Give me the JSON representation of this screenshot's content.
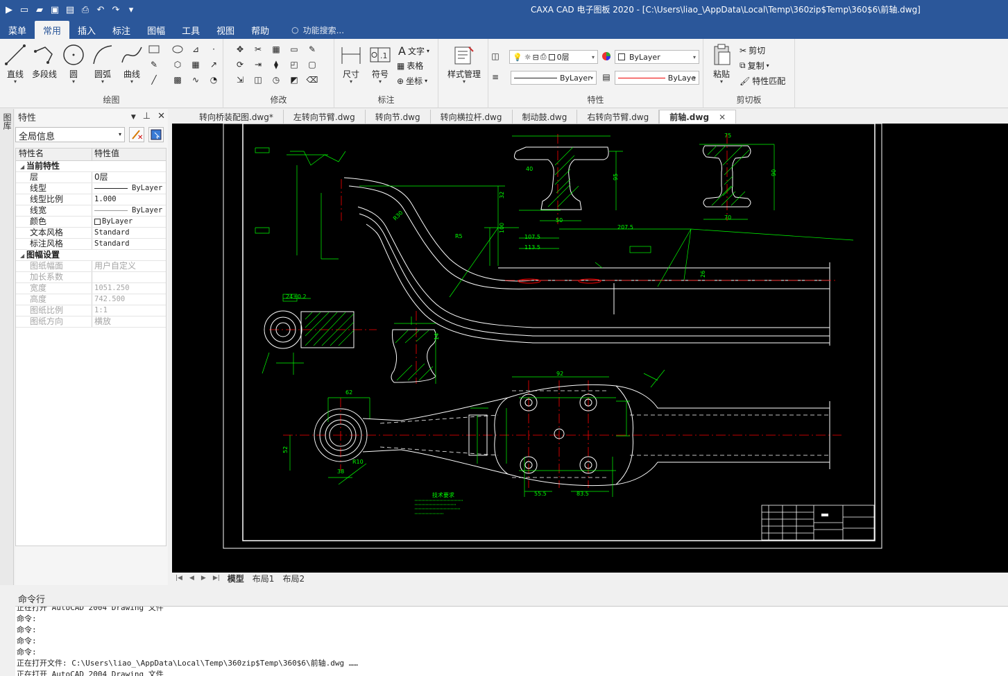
{
  "window": {
    "title": "CAXA CAD 电子图板 2020 - [C:\\Users\\liao_\\AppData\\Local\\Temp\\360zip$Temp\\360$6\\前轴.dwg]"
  },
  "menu": {
    "items": [
      "菜单",
      "常用",
      "插入",
      "标注",
      "图幅",
      "工具",
      "视图",
      "帮助"
    ],
    "active": "常用",
    "search_placeholder": "功能搜索..."
  },
  "ribbon": {
    "draw": {
      "label": "绘图",
      "line": "直线",
      "polyline": "多段线",
      "circle": "圆",
      "arc": "圆弧",
      "curve": "曲线"
    },
    "modify": {
      "label": "修改"
    },
    "annotate": {
      "label": "标注",
      "dimension": "尺寸",
      "symbol": "符号",
      "text": "文字",
      "table": "表格",
      "coord": "坐标"
    },
    "style": {
      "label": "样式管理"
    },
    "properties": {
      "label": "特性",
      "layer": "0层",
      "color": "ByLayer",
      "linetype": "ByLayer",
      "lineweight": "ByLaye"
    },
    "clipboard": {
      "label": "剪切板",
      "paste": "粘贴",
      "cut": "剪切",
      "copy": "复制",
      "match": "特性匹配"
    }
  },
  "panel": {
    "title": "特性",
    "selector": "全局信息",
    "side_tab": "图库",
    "columns": [
      "特性名",
      "特性值"
    ],
    "sections": [
      {
        "name": "当前特性",
        "rows": [
          {
            "k": "层",
            "v": "0层"
          },
          {
            "k": "线型",
            "v": "ByLayer"
          },
          {
            "k": "线型比例",
            "v": "1.000"
          },
          {
            "k": "线宽",
            "v": "ByLayer"
          },
          {
            "k": "颜色",
            "v": "ByLayer"
          },
          {
            "k": "文本风格",
            "v": "Standard"
          },
          {
            "k": "标注风格",
            "v": "Standard"
          }
        ]
      },
      {
        "name": "图幅设置",
        "rows": [
          {
            "k": "图纸幅面",
            "v": "用户自定义"
          },
          {
            "k": "加长系数",
            "v": ""
          },
          {
            "k": "宽度",
            "v": "1051.250"
          },
          {
            "k": "高度",
            "v": "742.500"
          },
          {
            "k": "图纸比例",
            "v": "1:1"
          },
          {
            "k": "图纸方向",
            "v": "横放"
          }
        ]
      }
    ]
  },
  "doc_tabs": {
    "items": [
      "转向桥装配图.dwg*",
      "左转向节臂.dwg",
      "转向节.dwg",
      "转向横拉杆.dwg",
      "制动鼓.dwg",
      "右转向节臂.dwg",
      "前轴.dwg"
    ],
    "active": "前轴.dwg"
  },
  "drawing": {
    "dims": [
      "75",
      "40",
      "90",
      "70",
      "50",
      "95",
      "207.5",
      "107.5",
      "113.5",
      "26",
      "32",
      "100",
      "24±0.2",
      "92",
      "62",
      "52",
      "38",
      "55.5",
      "83.5",
      "14",
      "R30",
      "R5",
      "R10"
    ],
    "note": "技术要求"
  },
  "layout_tabs": {
    "items": [
      "模型",
      "布局1",
      "布局2"
    ],
    "active": "模型"
  },
  "command": {
    "title": "命令行",
    "lines": [
      "正在打开 AutoCAD 2004 Drawing 文件",
      "命令:",
      "命令:",
      "命令:",
      "命令:",
      "正在打开文件: C:\\Users\\liao_\\AppData\\Local\\Temp\\360zip$Temp\\360$6\\前轴.dwg ……",
      "正在打开 AutoCAD 2004 Drawing 文件"
    ]
  },
  "colors": {
    "accent": "#2b579a",
    "canvas": "#000000",
    "cad_green": "#00ff00",
    "cad_red": "#ff0000",
    "cad_white": "#ffffff"
  }
}
